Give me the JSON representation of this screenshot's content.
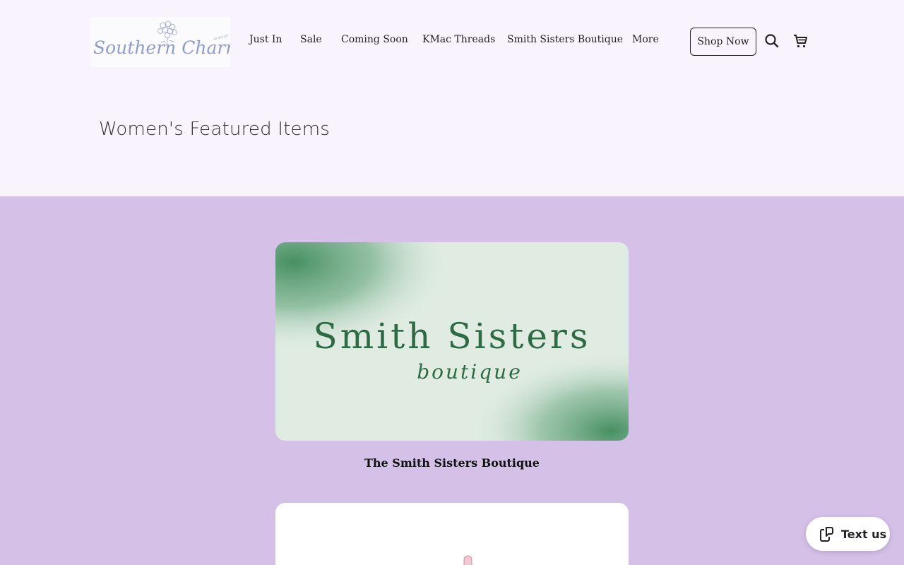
{
  "logo": {
    "script_text": "Southern Charmed",
    "small_text": "BY HOLLEY",
    "icon": "hydrangea-flower-icon"
  },
  "nav": {
    "items": [
      {
        "label": "Just In"
      },
      {
        "label": "Sale"
      },
      {
        "label": "Coming Soon"
      },
      {
        "label": "KMac Threads"
      },
      {
        "label": "Smith Sisters Boutique"
      },
      {
        "label": "More"
      }
    ],
    "shop_now": "Shop Now",
    "search_icon": "search-icon",
    "cart_icon": "cart-icon"
  },
  "hero": {
    "title": "Women's Featured Items"
  },
  "featured": {
    "items": [
      {
        "title": "The Smith Sisters Boutique",
        "image_title": "Smith Sisters",
        "image_subtitle": "boutique"
      }
    ]
  },
  "chat": {
    "label": "Text us",
    "icon": "chat-bubble-icon"
  },
  "colors": {
    "header_bg": "#f8f3fd",
    "page_bg": "#d5c0e8",
    "logo_text": "#8f9cc9",
    "boutique_green": "#2e6b45"
  }
}
